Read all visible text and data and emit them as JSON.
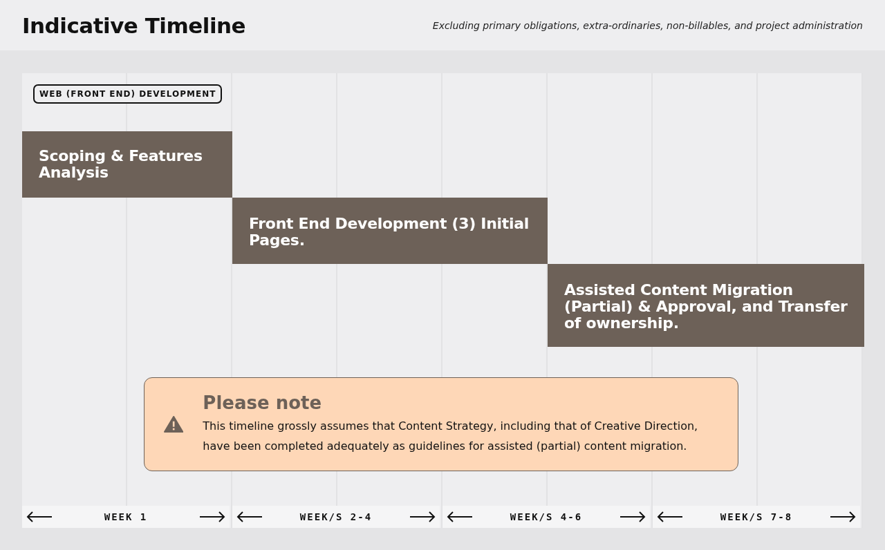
{
  "header": {
    "title": "Indicative Timeline",
    "subtitle": "Excluding primary obligations, extra-ordinaries,  non-billables, and project administration"
  },
  "track": {
    "label": "WEB (FRONT END) DEVELOPMENT"
  },
  "tasks": [
    {
      "label": "Scoping & Features Analysis"
    },
    {
      "label": "Front End Development (3) Initial Pages."
    },
    {
      "label": "Assisted Content Migration (Partial) & Approval, and Transfer of ownership."
    }
  ],
  "note": {
    "title": "Please note",
    "text": "This timeline grossly assumes that Content Strategy, including that of Creative Direction, have been completed adequately as guidelines for assisted (partial) content migration."
  },
  "weeks": [
    {
      "label": "WEEK 1"
    },
    {
      "label": "WEEK/S 2-4"
    },
    {
      "label": "WEEK/S 4-6"
    },
    {
      "label": "WEEK/S 7-8"
    }
  ]
}
